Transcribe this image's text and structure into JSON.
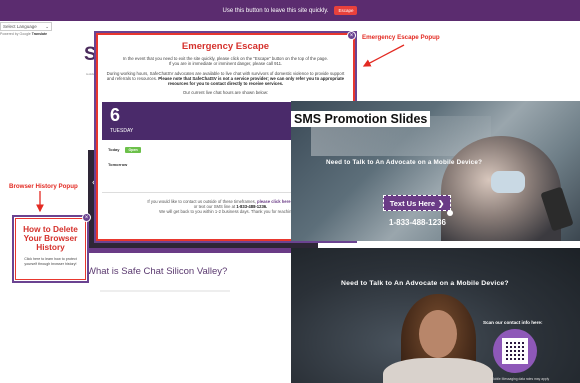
{
  "banner": {
    "message": "Use this button to leave this site quickly.",
    "escape_label": "Escape"
  },
  "translate": {
    "select_label": "Select Language",
    "chevron": "⌄",
    "powered_prefix": "Powered by",
    "powered_by": "Google",
    "translate_word": "Translate"
  },
  "site": {
    "logo": "S",
    "tagline": "to Address",
    "hero_arrow": "‹",
    "what_is": "What is Safe Chat Silicon Valley?"
  },
  "emergency_popup": {
    "annotation": "Emergency Escape Popup",
    "title": "Emergency Escape",
    "intro_line1": "In the event that you need to exit the site quickly, please click on the \"Escape\" button on the top of the page.",
    "intro_line2": "If you are in immediate or imminent danger, please call 911.",
    "body_part1": "During working hours, SafeChatSV advocates are available to live chat with survivors of domestic violence to provide support and referrals to resources.",
    "body_bold": "Please note that SafeChatSV is not a service provider; we can only refer you to appropriate resources for you to contact directly to receive services.",
    "hours_intro": "Our current live chat hours are shown below:",
    "date_number": "6",
    "weekday": "TUESDAY",
    "today_label": "Today",
    "today_status": "Open",
    "tomorrow_label": "Tomorrow",
    "footer_prefix": "If you would like to contact us outside of these timeframes,",
    "footer_link": "please click here to email us",
    "footer_mid": "or text our SMS line at",
    "footer_phone": "1-833-488-1236.",
    "footer_end": "We will get back to you within 1-2 business days. Thank you for reaching out.",
    "close": "×"
  },
  "history_popup": {
    "annotation": "Browser History Popup",
    "title_line1": "How to Delete",
    "title_line2": "Your Browser",
    "title_line3": "History",
    "sub": "Click here to learn how to protect yourself through browser history!",
    "close": "×"
  },
  "sms_slides": {
    "title": "SMS Promotion Slides",
    "slide1_headline": "Need to Talk to An Advocate on a Mobile Device?",
    "cta_label": "Text Us Here",
    "cta_arrow": "❯",
    "phone": "1-833-488-1236",
    "slide2_headline": "Need to Talk to An Advocate on a Mobile Device?",
    "scan_text": "Scan our contact info here:",
    "qr_footer": "Mobile Messaging data rates may apply"
  },
  "colors": {
    "brand_purple": "#6a3b86",
    "banner_purple": "#5b2c6f",
    "alert_red": "#e32a22"
  }
}
